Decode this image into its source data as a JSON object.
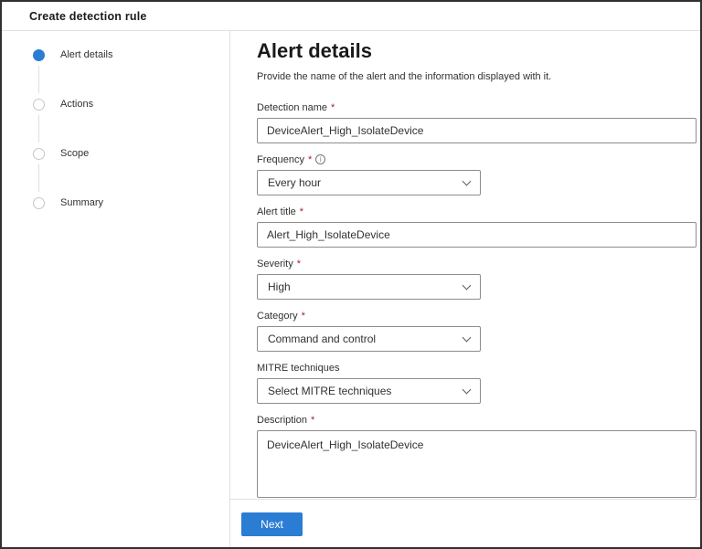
{
  "window": {
    "title": "Create detection rule"
  },
  "colors": {
    "accent_blue": "#2b7cd3",
    "required_red": "#a4262c",
    "border_gray": "#8f8d8b",
    "divider_gray": "#e1e1e1"
  },
  "wizard_steps": [
    {
      "label": "Alert details",
      "active": true
    },
    {
      "label": "Actions",
      "active": false
    },
    {
      "label": "Scope",
      "active": false
    },
    {
      "label": "Summary",
      "active": false
    }
  ],
  "main": {
    "title": "Alert details",
    "subtitle": "Provide the name of the alert and the information displayed with it.",
    "fields": {
      "detection_name": {
        "label": "Detection name",
        "required": "*",
        "value": "DeviceAlert_High_IsolateDevice"
      },
      "frequency": {
        "label": "Frequency",
        "required": "*",
        "value": "Every hour"
      },
      "alert_title": {
        "label": "Alert title",
        "required": "*",
        "value": "Alert_High_IsolateDevice"
      },
      "severity": {
        "label": "Severity",
        "required": "*",
        "value": "High"
      },
      "category": {
        "label": "Category",
        "required": "*",
        "value": "Command and control"
      },
      "mitre_techniques": {
        "label": "MITRE techniques",
        "value": "Select MITRE techniques"
      },
      "description": {
        "label": "Description",
        "required": "*",
        "value": "DeviceAlert_High_IsolateDevice"
      }
    },
    "footer": {
      "next_label": "Next"
    }
  },
  "icons": {
    "info": "i"
  }
}
